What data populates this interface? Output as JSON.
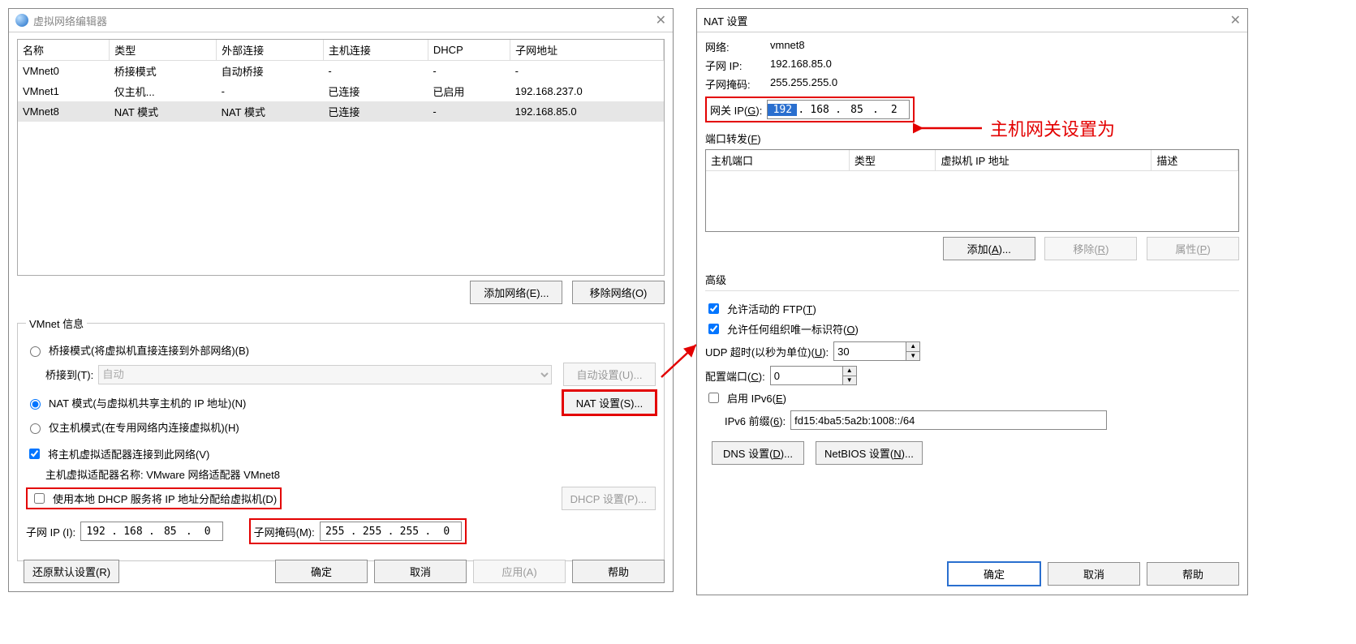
{
  "left": {
    "title": "虚拟网络编辑器",
    "cols": [
      "名称",
      "类型",
      "外部连接",
      "主机连接",
      "DHCP",
      "子网地址"
    ],
    "rows": [
      {
        "n": "VMnet0",
        "t": "桥接模式",
        "e": "自动桥接",
        "h": "-",
        "d": "-",
        "s": "-",
        "sel": false
      },
      {
        "n": "VMnet1",
        "t": "仅主机...",
        "e": "-",
        "h": "已连接",
        "d": "已启用",
        "s": "192.168.237.0",
        "sel": false
      },
      {
        "n": "VMnet8",
        "t": "NAT 模式",
        "e": "NAT 模式",
        "h": "已连接",
        "d": "-",
        "s": "192.168.85.0",
        "sel": true
      }
    ],
    "add_net": "添加网络(E)...",
    "remove_net": "移除网络(O)",
    "vmnet_info": "VMnet 信息",
    "opt_bridge": "桥接模式(将虚拟机直接连接到外部网络)(B)",
    "bridge_to": "桥接到(T):",
    "bridge_auto": "自动",
    "auto_set": "自动设置(U)...",
    "opt_nat": "NAT 模式(与虚拟机共享主机的 IP 地址)(N)",
    "nat_set": "NAT 设置(S)...",
    "opt_host": "仅主机模式(在专用网络内连接虚拟机)(H)",
    "chk_adapter": "将主机虚拟适配器连接到此网络(V)",
    "adapter_name_lbl": "主机虚拟适配器名称: VMware 网络适配器 VMnet8",
    "chk_dhcp": "使用本地 DHCP 服务将 IP 地址分配给虚拟机(D)",
    "dhcp_set": "DHCP 设置(P)...",
    "subnet_ip_lbl": "子网 IP (I):",
    "subnet_ip": [
      "192",
      "168",
      "85",
      "0"
    ],
    "mask_lbl": "子网掩码(M):",
    "mask": [
      "255",
      "255",
      "255",
      "0"
    ],
    "restore": "还原默认设置(R)",
    "ok": "确定",
    "cancel": "取消",
    "apply": "应用(A)",
    "help": "帮助"
  },
  "right": {
    "title": "NAT 设置",
    "net_lbl": "网络:",
    "net_val": "vmnet8",
    "sub_lbl": "子网 IP:",
    "sub_val": "192.168.85.0",
    "mask_lbl": "子网掩码:",
    "mask_val": "255.255.255.0",
    "gw_lbl_pre": "网关 IP(",
    "gw_key": "G",
    "gw_lbl_post": "):",
    "gw": [
      "192",
      "168",
      "85",
      "2"
    ],
    "pf_lbl_pre": "端口转发(",
    "pf_key": "F",
    "pf_lbl_post": ")",
    "pf_cols": [
      "主机端口",
      "类型",
      "虚拟机 IP 地址",
      "描述"
    ],
    "add_pre": "添加(",
    "add_key": "A",
    "add_post": ")...",
    "rem_pre": "移除(",
    "rem_key": "R",
    "rem_post": ")",
    "prop_pre": "属性(",
    "prop_key": "P",
    "prop_post": ")",
    "adv": "高级",
    "ftp_pre": "允许活动的 FTP(",
    "ftp_key": "T",
    "ftp_post": ")",
    "org_pre": "允许任何组织唯一标识符(",
    "org_key": "O",
    "org_post": ")",
    "udp_pre": "UDP 超时(以秒为单位)(",
    "udp_key": "U",
    "udp_post": "):",
    "udp_val": "30",
    "port_pre": "配置端口(",
    "port_key": "C",
    "port_post": "):",
    "port_val": "0",
    "ipv6_pre": "启用 IPv6(",
    "ipv6_key": "E",
    "ipv6_post": ")",
    "pref_pre": "IPv6 前缀(",
    "pref_key": "6",
    "pref_post": "):",
    "pref_val": "fd15:4ba5:5a2b:1008::/64",
    "dns_pre": "DNS 设置(",
    "dns_key": "D",
    "dns_post": ")...",
    "nb_pre": "NetBIOS 设置(",
    "nb_key": "N",
    "nb_post": ")...",
    "ok": "确定",
    "cancel": "取消",
    "help": "帮助"
  },
  "annot": "主机网关设置为"
}
